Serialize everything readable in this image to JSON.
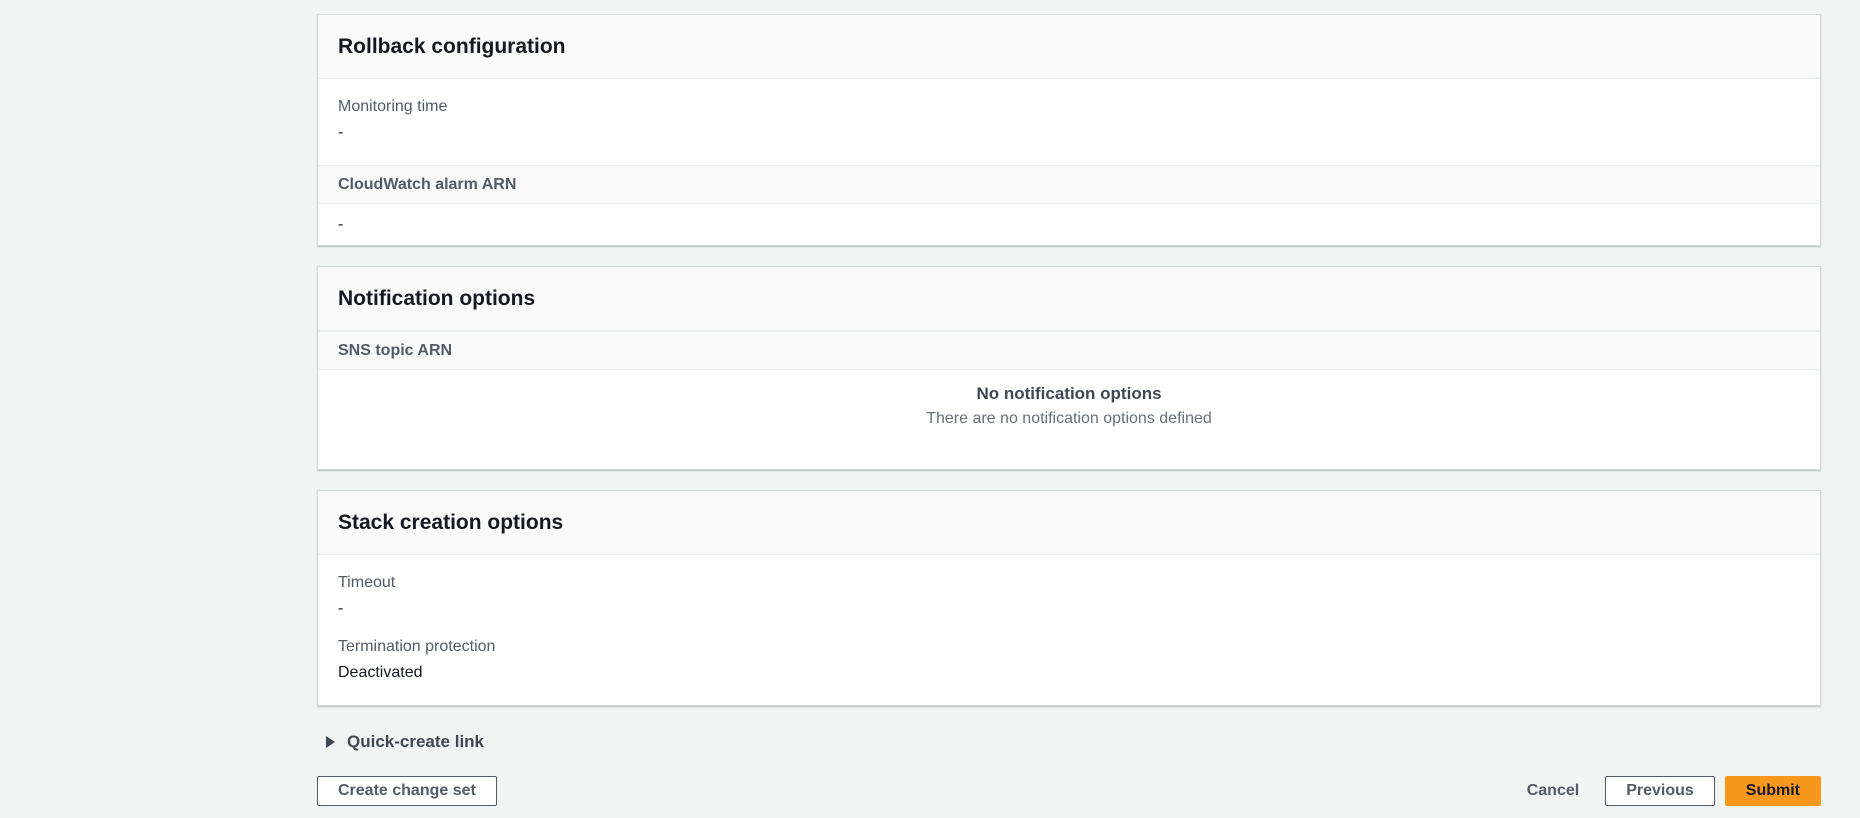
{
  "rollback": {
    "title": "Rollback configuration",
    "monitoring_label": "Monitoring time",
    "monitoring_value": "-",
    "alarm_label": "CloudWatch alarm ARN",
    "alarm_value": "-"
  },
  "notification": {
    "title": "Notification options",
    "sns_label": "SNS topic ARN",
    "empty_title": "No notification options",
    "empty_desc": "There are no notification options defined"
  },
  "stack_options": {
    "title": "Stack creation options",
    "timeout_label": "Timeout",
    "timeout_value": "-",
    "termination_label": "Termination protection",
    "termination_value": "Deactivated"
  },
  "quick_create": {
    "label": "Quick-create link",
    "icon": "caret-right-icon"
  },
  "footer": {
    "create_change_set_label": "Create change set",
    "cancel_label": "Cancel",
    "previous_label": "Previous",
    "submit_label": "Submit"
  },
  "colors": {
    "page_background": "#f2f3f3",
    "panel_background": "#ffffff",
    "panel_header_background": "#fafafa",
    "border": "#eaeded",
    "label_gray": "#545b64",
    "text_dark": "#16191f",
    "primary_button": "#f7981d"
  }
}
